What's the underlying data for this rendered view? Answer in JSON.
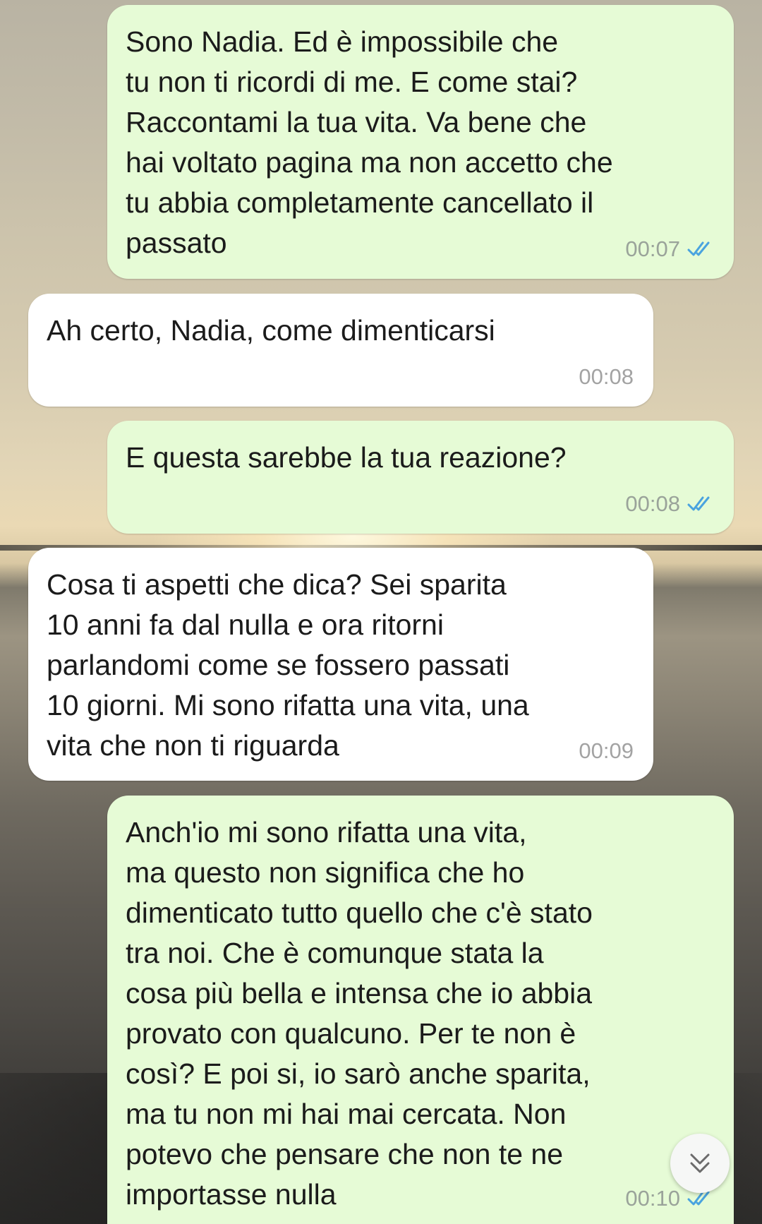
{
  "messages": [
    {
      "direction": "out",
      "text": "Sono Nadia. Ed è impossibile che\ntu non ti ricordi di me. E come stai?\nRaccontami la tua vita. Va bene che\nhai voltato pagina ma non accetto che\ntu abbia completamente cancellato il\npassato",
      "time": "00:07",
      "status": "read"
    },
    {
      "direction": "in",
      "text": "Ah certo, Nadia, come dimenticarsi",
      "time": "00:08"
    },
    {
      "direction": "out",
      "text": "E questa sarebbe la tua reazione?",
      "time": "00:08",
      "status": "read"
    },
    {
      "direction": "in",
      "text": "Cosa ti aspetti che dica? Sei sparita\n10 anni fa dal nulla e ora ritorni\nparlandomi come se fossero passati\n10 giorni. Mi sono rifatta una vita, una\nvita che non ti riguarda",
      "time": "00:09"
    },
    {
      "direction": "out",
      "text": "Anch'io mi sono rifatta una vita,\nma questo non significa che ho\ndimenticato tutto quello che c'è stato\ntra noi. Che è comunque stata la\ncosa più bella e intensa che io abbia\nprovato con qualcuno. Per te non è\ncosì? E poi si, io sarò anche sparita,\nma tu non mi hai mai cercata. Non\npotevo che pensare che non te ne\nimportasse nulla",
      "time": "00:10",
      "status": "read"
    }
  ],
  "icons": {
    "read_ticks": "double-check-icon",
    "scroll_down": "chevron-double-down-icon"
  },
  "colors": {
    "outgoing_bubble": "#e6fbd6",
    "incoming_bubble": "#ffffff",
    "read_ticks": "#4aa3df"
  }
}
